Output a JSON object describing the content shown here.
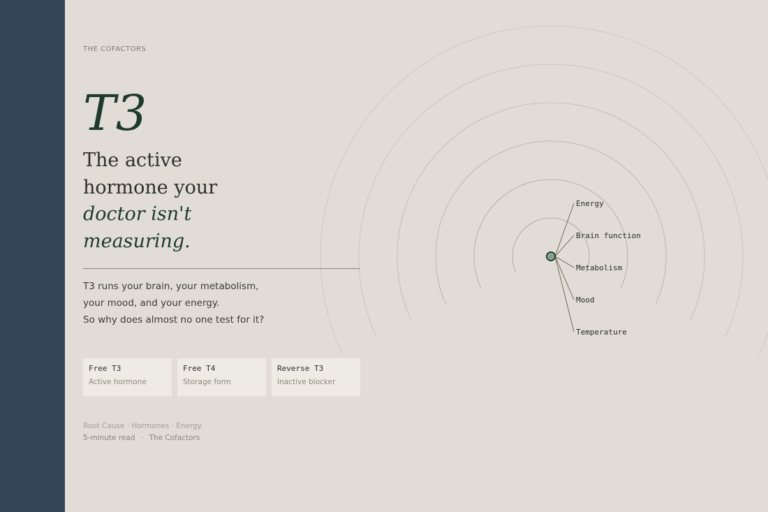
{
  "eyebrow": "THE COFACTORS",
  "title": "T3",
  "headline": {
    "line1": "The active",
    "line2": "hormone your",
    "line3": "doctor isn't",
    "line4": "measuring."
  },
  "lede": {
    "line1": "T3 runs your brain, your metabolism,",
    "line2": "your mood, and your energy.",
    "line3": "So why does almost no one test for it?"
  },
  "cards": [
    {
      "name": "Free T3",
      "desc": "Active hormone"
    },
    {
      "name": "Free T4",
      "desc": "Storage form"
    },
    {
      "name": "Reverse T3",
      "desc": "Inactive blocker"
    }
  ],
  "tags": "Root Cause · Hormones · Energy",
  "meta": {
    "read_time": "5-minute read",
    "separator": "·",
    "publisher": "The Cofactors"
  },
  "diagram": {
    "labels": [
      "Energy",
      "Brain function",
      "Metabolism",
      "Mood",
      "Temperature"
    ]
  },
  "colors": {
    "sidebar": "#344558",
    "background": "#e1ddd6",
    "accent": "#1e3a2d",
    "card": "#eeebe4"
  }
}
